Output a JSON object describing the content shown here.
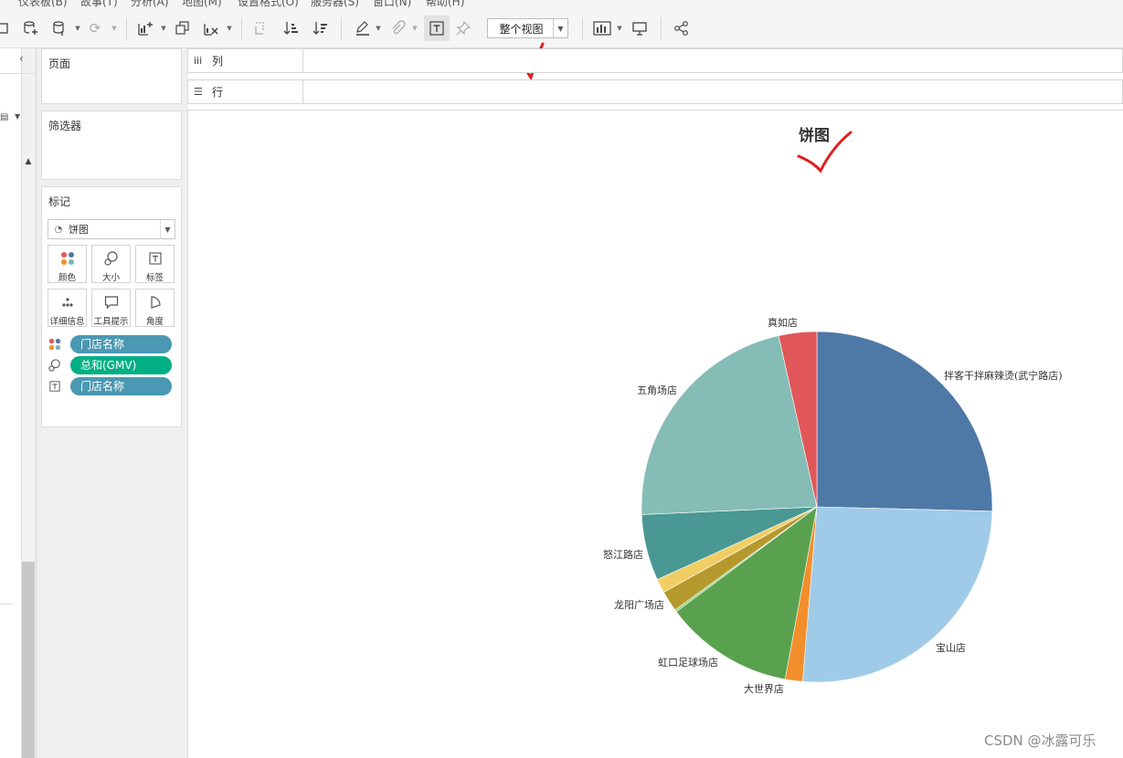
{
  "menubar": {
    "items": [
      "仪表板(B)",
      "故事(T)",
      "分析(A)",
      "地图(M)",
      "设置格式(O)",
      "服务器(S)",
      "窗口(N)",
      "帮助(H)"
    ]
  },
  "toolbar": {
    "view_mode": "整个视图",
    "icons": [
      "new-sheet-icon",
      "add-datasource-icon",
      "datasource-icon",
      "refresh-icon",
      "new-worksheet-icon",
      "duplicate-sheet-icon",
      "clear-sheet-icon",
      "swap-icon",
      "sort-ascending-icon",
      "sort-descending-icon",
      "highlight-icon",
      "group-icon",
      "show-labels-icon",
      "pin-icon",
      "show-me-icon",
      "presentation-icon",
      "share-icon"
    ]
  },
  "left_panel": {
    "pages_title": "页面",
    "filters_title": "筛选器",
    "marks_title": "标记",
    "mark_type": "饼图",
    "mark_buttons": [
      {
        "label": "颜色",
        "icon": "color-dots-icon"
      },
      {
        "label": "大小",
        "icon": "size-icon"
      },
      {
        "label": "标签",
        "icon": "label-icon"
      },
      {
        "label": "详细信息",
        "icon": "detail-icon"
      },
      {
        "label": "工具提示",
        "icon": "tooltip-icon"
      },
      {
        "label": "角度",
        "icon": "angle-icon"
      }
    ],
    "pills": [
      {
        "icon": "color-dots-icon",
        "label": "门店名称",
        "color": "#4a98b2"
      },
      {
        "icon": "size-icon",
        "label": "总和(GMV)",
        "color": "#00b084"
      },
      {
        "icon": "label-icon",
        "label": "门店名称",
        "color": "#4a98b2"
      }
    ]
  },
  "shelves": {
    "columns": "列",
    "rows": "行"
  },
  "chart_data": {
    "type": "pie",
    "title": "饼图",
    "slices": [
      {
        "label": "拌客干拌麻辣烫(武宁路店)",
        "value": 25.4,
        "color": "#4e79a7"
      },
      {
        "label": "宝山店",
        "value": 25.9,
        "color": "#a0cbe8"
      },
      {
        "label": "大世界店",
        "value": 1.6,
        "color": "#f28e2b"
      },
      {
        "label": "虹口足球场店",
        "value": 11.9,
        "color": "#59a14f"
      },
      {
        "label": "",
        "value": 0.2,
        "color": "#8cd17d"
      },
      {
        "label": "龙阳广场店",
        "value": 1.9,
        "color": "#b6992d"
      },
      {
        "label": "",
        "value": 1.3,
        "color": "#f1ce63"
      },
      {
        "label": "怒江路店",
        "value": 6.1,
        "color": "#499894"
      },
      {
        "label": "五角场店",
        "value": 22.2,
        "color": "#86bcb6"
      },
      {
        "label": "真如店",
        "value": 3.5,
        "color": "#e15759"
      }
    ]
  },
  "watermark": "CSDN @冰露可乐"
}
